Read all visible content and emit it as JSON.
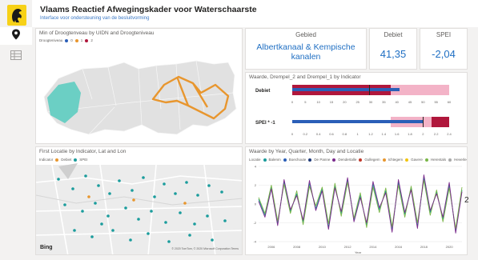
{
  "header": {
    "title": "Vlaams Reactief Afwegingskader voor Waterschaarste",
    "subtitle": "Interface voor ondersteuning van de besluitvorming"
  },
  "sidebar": {
    "items": [
      {
        "icon": "map-pin-icon",
        "selected": true
      },
      {
        "icon": "table-icon",
        "selected": false
      }
    ]
  },
  "colors": {
    "accent_blue": "#1f6fc3",
    "bar_dark_red": "#b0173c",
    "bar_light_pink": "#f3b3c7",
    "bar_blue": "#2b5fb8",
    "map_orange": "#e8962e",
    "map_teal": "#6bcfc4"
  },
  "map_tile": {
    "title": "Min of Droogtenveau by UIDN and Droogteniveau",
    "legend_label": "Droogteniveau",
    "legend_items": [
      {
        "label": "0",
        "color": "#2b5fb8"
      },
      {
        "label": "1",
        "color": "#e8962e"
      },
      {
        "label": "2",
        "color": "#b0173c"
      }
    ]
  },
  "cards": {
    "gebied": {
      "label": "Gebied",
      "value": "Albertkanaal & Kempische kanalen"
    },
    "debiet": {
      "label": "Debiet",
      "value": "41,35"
    },
    "spei": {
      "label": "SPEI",
      "value": "-2,04"
    }
  },
  "bullet_tile": {
    "title": "Waarde, Drempel_2 and Drempel_1 by Indicator",
    "rows": [
      {
        "label": "Debiet",
        "ticks": [
          "0",
          "5",
          "10",
          "15",
          "20",
          "25",
          "30",
          "35",
          "40",
          "45",
          "50",
          "55",
          "60"
        ]
      },
      {
        "label": "SPEI * -1",
        "ticks": [
          "0",
          "0.2",
          "0.4",
          "0.6",
          "0.8",
          "1",
          "1.2",
          "1.4",
          "1.6",
          "1.8",
          "2",
          "2.2",
          "2.4"
        ]
      }
    ]
  },
  "location_tile": {
    "title": "First Locatie by Indicator, Lat and Lon",
    "legend_label": "Indicator",
    "legend_items": [
      {
        "label": "Debiet",
        "color": "#e8962e"
      },
      {
        "label": "SPEI",
        "color": "#1a9c9c"
      }
    ],
    "bing_label": "Bing",
    "copyright": "© 2020 TomTom, © 2020 Microsoft Corporation Terms"
  },
  "line_tile": {
    "title": "Waarde by Year, Quarter, Month, Day and Locatie",
    "legend_label": "Locatie",
    "legend_items": [
      {
        "label": "Balenm",
        "color": "#1a9c9c"
      },
      {
        "label": "Boechoute",
        "color": "#2b5fb8"
      },
      {
        "label": "De Panne",
        "color": "#1f3a7a"
      },
      {
        "label": "Dendertalle",
        "color": "#7a2a8c"
      },
      {
        "label": "Gullegem",
        "color": "#c0392b"
      },
      {
        "label": "Ichtegem",
        "color": "#e8962e"
      },
      {
        "label": "Gavere",
        "color": "#f1c40f"
      },
      {
        "label": "Herentals",
        "color": "#7ab648"
      },
      {
        "label": "Heverlee",
        "color": "#a9a9a9"
      }
    ],
    "x_label": "Year",
    "edge_text": "2"
  },
  "chart_data": {
    "type": "line",
    "title": "Waarde by Year, Quarter, Month, Day and Locatie",
    "xlabel": "Year",
    "ylabel": "",
    "x_ticks": [
      "2006",
      "2008",
      "2010",
      "2012",
      "2014",
      "2016",
      "2018",
      "2020"
    ],
    "y_ticks": [
      "4",
      "2",
      "0",
      "-2",
      "-4"
    ],
    "ylim": [
      -4,
      4
    ],
    "xlim": [
      2005,
      2021
    ],
    "series": [
      {
        "name": "Balenm",
        "values": [
          0.5,
          -1.2,
          1.8,
          -2.1,
          2.4,
          -0.8,
          1.1,
          -1.9,
          2.2,
          -0.5,
          1.6,
          -2.5,
          1.9,
          -1.0,
          2.6,
          -1.7,
          0.9,
          -2.2,
          2.1,
          -0.6,
          1.4,
          -2.8,
          2.3,
          -1.1,
          1.7,
          -2.4,
          2.8,
          -0.9,
          1.3,
          -1.6,
          2.0,
          -2.9,
          1.5
        ]
      },
      {
        "name": "Herentals",
        "values": [
          0.7,
          -1.0,
          2.0,
          -1.8,
          2.1,
          -1.0,
          1.4,
          -2.2,
          1.9,
          -0.2,
          1.8,
          -2.1,
          2.2,
          -1.3,
          2.3,
          -1.5,
          1.2,
          -2.5,
          1.8,
          -0.9,
          1.7,
          -2.4,
          2.0,
          -1.4,
          1.9,
          -2.0,
          2.5,
          -1.2,
          1.5,
          -1.9,
          1.7,
          -2.6,
          1.8
        ]
      },
      {
        "name": "Dendertalle",
        "values": [
          0.3,
          -1.4,
          1.6,
          -2.3,
          2.6,
          -0.6,
          0.9,
          -1.7,
          2.5,
          -0.7,
          1.4,
          -2.7,
          1.7,
          -0.8,
          2.8,
          -1.9,
          0.7,
          -2.0,
          2.4,
          -0.4,
          1.2,
          -3.0,
          2.6,
          -0.9,
          1.5,
          -2.6,
          3.1,
          -0.7,
          1.1,
          -1.4,
          2.3,
          -3.1,
          1.3
        ]
      }
    ]
  }
}
